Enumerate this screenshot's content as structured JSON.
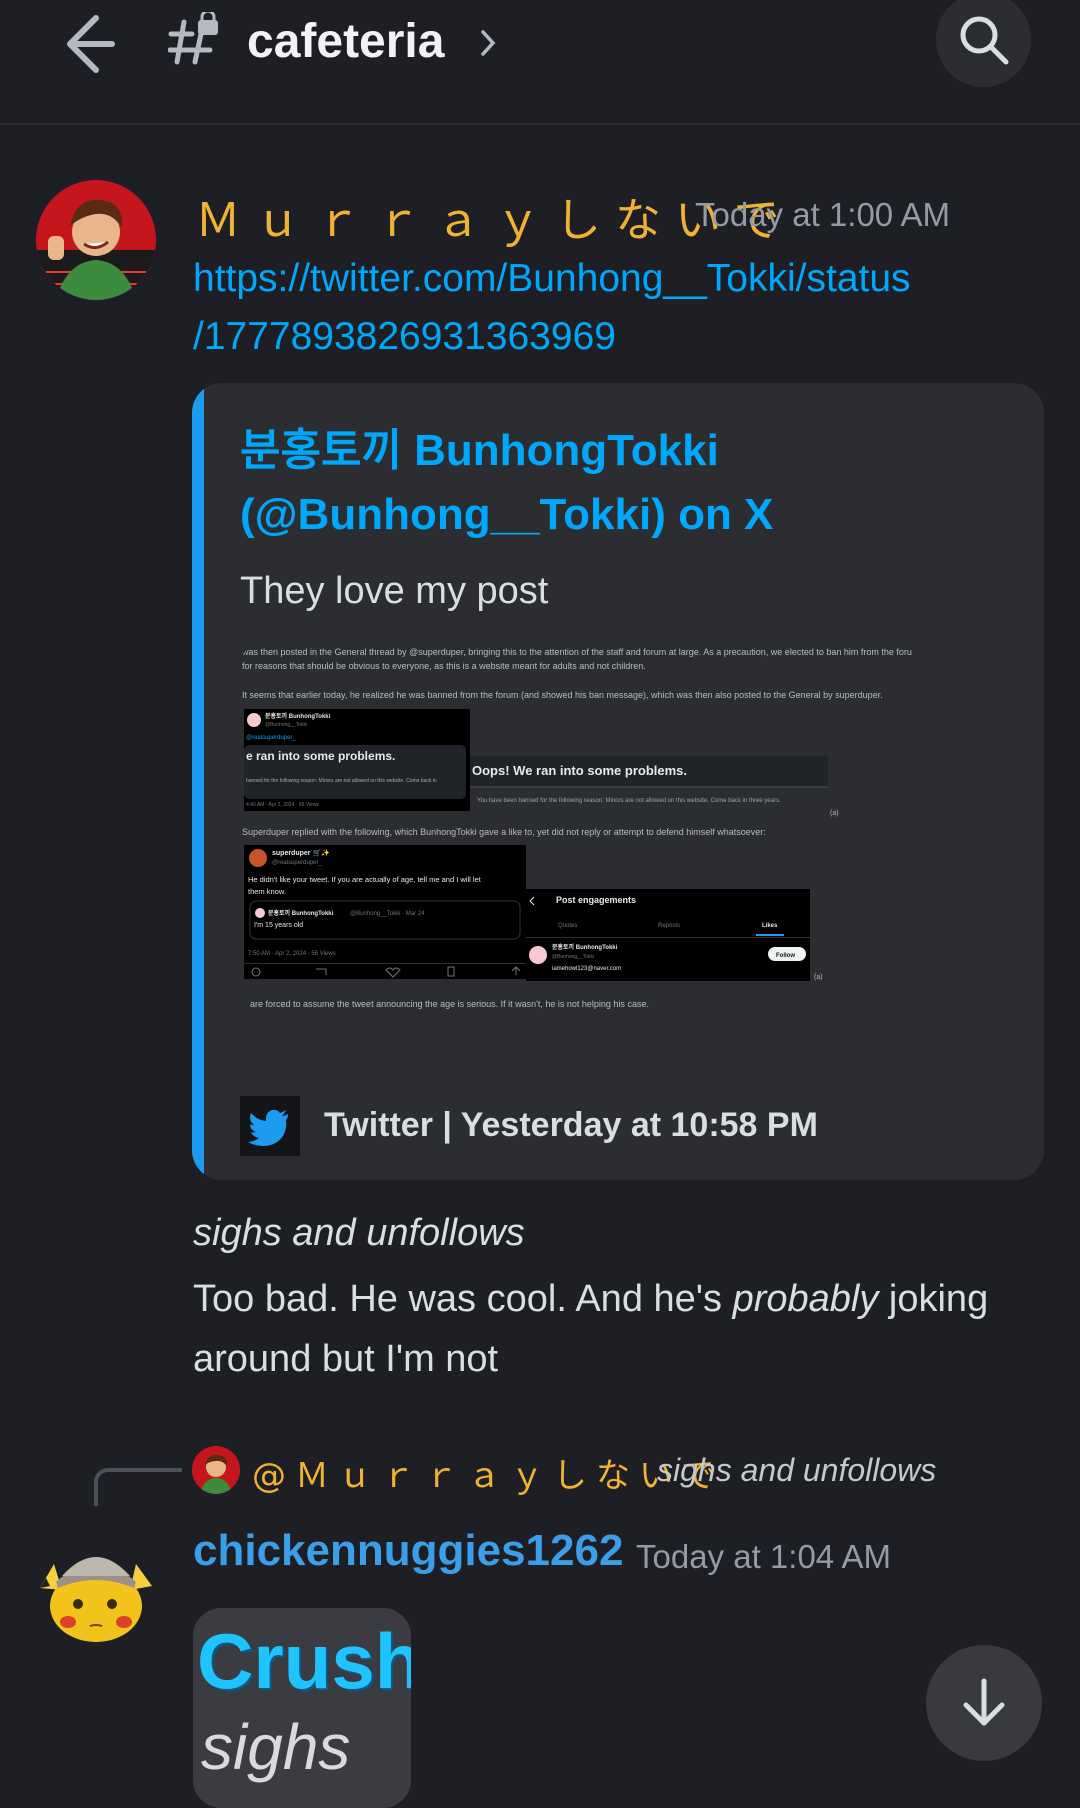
{
  "header": {
    "channel_name": "cafeteria"
  },
  "message1": {
    "author": "Ｍｕｒｒａｙしないで",
    "timestamp": "Today at 1:00 AM",
    "link_line1": "https://twitter.com/Bunhong__Tokki/status",
    "link_line2": "/1777893826931363969",
    "embed": {
      "title_line1": "분홍토끼 BunhongTokki",
      "title_line2": "(@Bunhong__Tokki) on X",
      "description": "They love my post",
      "footer": "Twitter | Yesterday at 10:58 PM",
      "footer_icon": "twitter-bird-icon",
      "accent_color": "#1d9bf0",
      "image": {
        "line_a": "was then posted in the General thread by @superduper, bringing this to the attention of the staff and forum at large. As a precaution, we elected to ban him from the foru",
        "line_b": "for reasons that should be obvious to everyone, as this is a website meant for adults and not children.",
        "line_c": "It seems that earlier today, he realized he was banned from the forum (and showed his ban message), which was then also posted to the General by superduper.",
        "tweet1_name": "분홍토끼 BunhongTokki",
        "tweet1_handle": "@Bunhong__Tokki",
        "tweet1_reply_to": "@realsuperduper_",
        "tweet1_text": "e ran into some problems.",
        "tweet1_sub": "banned for the following reason: Minors are not allowed on this website. Come back in",
        "tweet1_meta": "4:40 AM · Apr 2, 2024 · 96 Views",
        "oops_text": "Oops! We ran into some problems.",
        "ban_text": "You have been banned for the following reason: Minors are not allowed on this website. Come back in three years.",
        "mark_a": "(a)",
        "line_d": "Superduper replied with the following, which BunhongTokki gave a like to, yet did not reply or attempt to defend himself whatsoever:",
        "tweet2_name": "superduper 🛒✨",
        "tweet2_handle": "@realsuperduper_",
        "tweet2_text1": "He didn't like your tweet. If you are actually of age, tell me and I will let",
        "tweet2_text2": "them know.",
        "quote_name": "분홍토끼 BunhongTokki",
        "quote_meta": "@Bunhong__Tokki · Mar 24",
        "quote_text": "I'm 15 years old",
        "tweet2_meta": "7:50 AM · Apr 2, 2024 · 56 Views",
        "engagements_title": "Post engagements",
        "tab_quotes": "Quotes",
        "tab_reposts": "Reposts",
        "tab_likes": "Likes",
        "liker_name": "분홍토끼 BunhongTokki",
        "liker_handle": "@Bunhong__Tokki",
        "liker_email": "iamehowl123@naver.com",
        "follow_label": "Follow",
        "mark_b": "(a)",
        "line_e": "are forced to assume the tweet announcing the age is serious. If it wasn't, he is not helping his case."
      }
    },
    "followup1": "sighs and unfollows",
    "followup2_part1": "Too bad. He was cool. And he's ",
    "followup2_emph": "probably",
    "followup2_part2": " joking",
    "followup3": "around but I'm not"
  },
  "message2": {
    "reply_author": "@Ｍｕｒｒａｙしないで",
    "reply_text": "sighs and unfollows",
    "author": "chickennuggies1262",
    "timestamp": "Today at 1:04 AM",
    "attachment_text1": "Crush",
    "attachment_text2": "sighs"
  },
  "colors": {
    "background": "#1e1f24",
    "link": "#00a8fc",
    "author1": "#f0b232",
    "author2": "#3b9ee8",
    "muted": "#949ba4"
  }
}
